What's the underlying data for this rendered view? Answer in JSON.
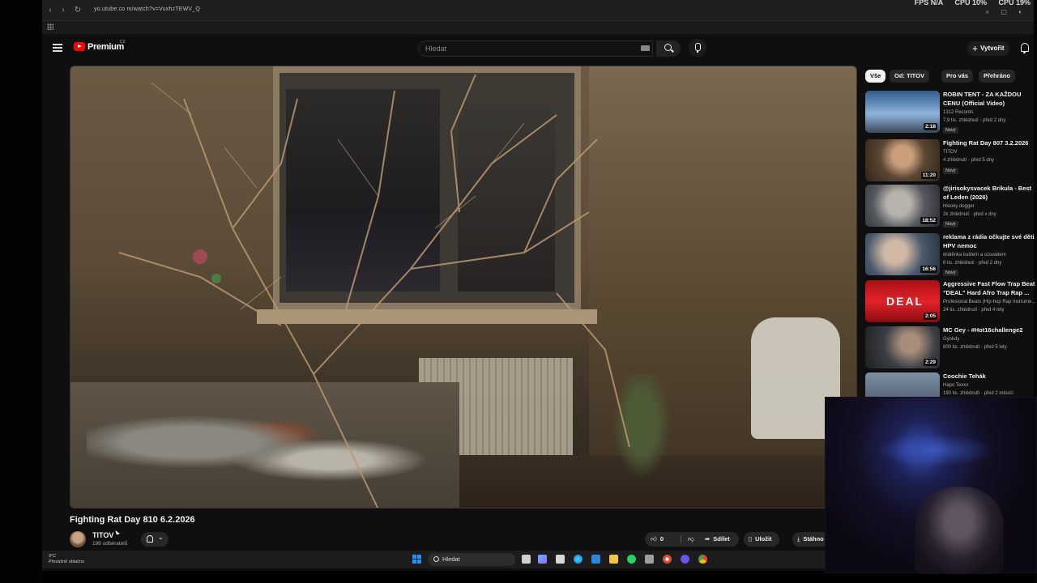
{
  "browser": {
    "url": "yo.utube.co m/watch?v=VuxhzTEWV_Q",
    "stats": [
      "FPS N/A",
      "CPU 10%",
      "CPU 19%"
    ]
  },
  "masthead": {
    "logo_text": "Premium",
    "region": "CZ",
    "search_placeholder": "Hledat",
    "create_label": "Vytvořit"
  },
  "video": {
    "title": "Fighting Rat Day 810 6.2.2026",
    "channel": "TITOV",
    "subscribers": "198 odběratelů",
    "likes": "0",
    "share_label": "Sdílet",
    "save_label": "Uložit",
    "download_label": "Stáhno"
  },
  "chips": [
    "Vše",
    "Od: TITOV",
    "Pro vás",
    "Přehráno"
  ],
  "recommendations": [
    {
      "title": "ROBIN TENT - ZA KAŽDOU CENU (Official Video)",
      "channel": "1312 Records",
      "stats": "7,9 tis. zhlédnutí · před 2 dny",
      "badge": "Nový",
      "duration": "2:18",
      "thumb": "#5a7fa8"
    },
    {
      "title": "Fighting Rat Day 807 3.2.2026",
      "channel": "TITOV",
      "stats": "4 zhlédnutí · před 5 dny",
      "badge": "Nový",
      "duration": "11:20",
      "thumb": "#7a5f44"
    },
    {
      "title": "@jirisokysvacek Brikula - Best of Leden (2026)",
      "channel": "Hlooky dogger",
      "stats": "2k zhlédnutí · před x dny",
      "badge": "Nový",
      "duration": "18:52",
      "thumb": "#6a6e78"
    },
    {
      "title": "reklama z rádia očkujte své děti HPV nemoc",
      "channel": "drátěnka kutilem a ozsvaltem",
      "stats": "8 tis. zhlédnutí · před 2 dny",
      "badge": "Nový",
      "duration": "16:56",
      "thumb": "#4a5a6e"
    },
    {
      "title": "Aggressive Fast Flow Trap Beat \"DEAL\" Hard Afro Trap Rap ...",
      "channel": "Profesional Beats (Hip-hop Rap Instrume...",
      "stats": "24 tis. zhlédnutí · před 4 lety",
      "badge": "",
      "duration": "2:05",
      "thumb": "#c0151b"
    },
    {
      "title": "MC Gey - #Hot16challenge2",
      "channel": "Gyokdy",
      "stats": "800 tis. zhlédnutí · před 5 lety",
      "badge": "",
      "duration": "2:29",
      "thumb": "#3b3f44"
    },
    {
      "title": "Coochie Tehák",
      "channel": "Hapo Texxx",
      "stats": "190 tis. zhlédnutí · před 2 měsíci",
      "badge": "",
      "duration": "",
      "thumb": "#5d6a7a"
    }
  ],
  "taskbar": {
    "weather_temp": "9°C",
    "weather_text": "Převážně oblačno",
    "search_placeholder": "Hledat"
  },
  "colors": {
    "accent_red": "#ff0000",
    "page_bg": "#0f0f0f",
    "chip_bg": "#272727"
  }
}
